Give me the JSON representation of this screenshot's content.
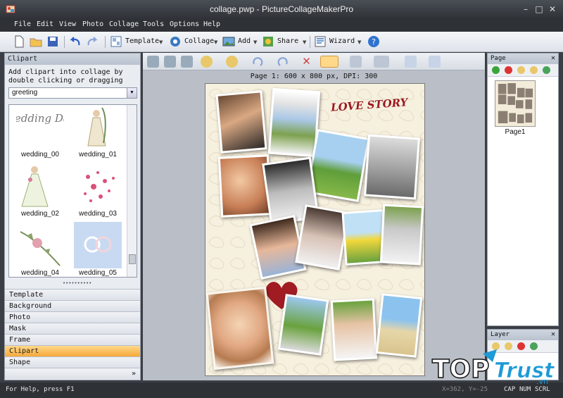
{
  "window": {
    "title": "collage.pwp - PictureCollageMakerPro",
    "minimize": "–",
    "maximize": "□",
    "close": "✕"
  },
  "menu": [
    "File",
    "Edit",
    "View",
    "Photo",
    "Collage",
    "Tools",
    "Options",
    "Help"
  ],
  "toolbar": {
    "template": "Template",
    "collage": "Collage",
    "add": "Add",
    "share": "Share",
    "wizard": "Wizard"
  },
  "left_panel": {
    "header": "Clipart",
    "description": "Add clipart into collage by double clicking or dragging",
    "category": "greeting",
    "items": [
      {
        "label": "wedding_00",
        "art": "Wedding Day"
      },
      {
        "label": "wedding_01"
      },
      {
        "label": "wedding_02"
      },
      {
        "label": "wedding_03"
      },
      {
        "label": "wedding_04"
      },
      {
        "label": "wedding_05"
      }
    ],
    "resize_grip": "••••••••••",
    "tabs": [
      "Template",
      "Background",
      "Photo",
      "Mask",
      "Frame",
      "Clipart",
      "Shape"
    ],
    "active_tab": "Clipart",
    "more": "»"
  },
  "canvas": {
    "page_info": "Page 1: 600 x 800 px, DPI: 300",
    "love_text": "LOVE STORY"
  },
  "page_panel": {
    "header": "Page",
    "close": "✕",
    "page_label": "Page1"
  },
  "layer_panel": {
    "header": "Layer",
    "close": "✕"
  },
  "status": {
    "help": "For Help, press F1",
    "coords": "X=362, Y=-25",
    "cap": "CAP",
    "num": "NUM",
    "scrl": "SCRL"
  },
  "watermark": {
    "text1": "TOP",
    "text2": "Trust",
    "sub": ".vn"
  },
  "colors": {
    "accent": "#f6a83a",
    "title_bg": "#2f3237",
    "love": "#9b1a22"
  }
}
